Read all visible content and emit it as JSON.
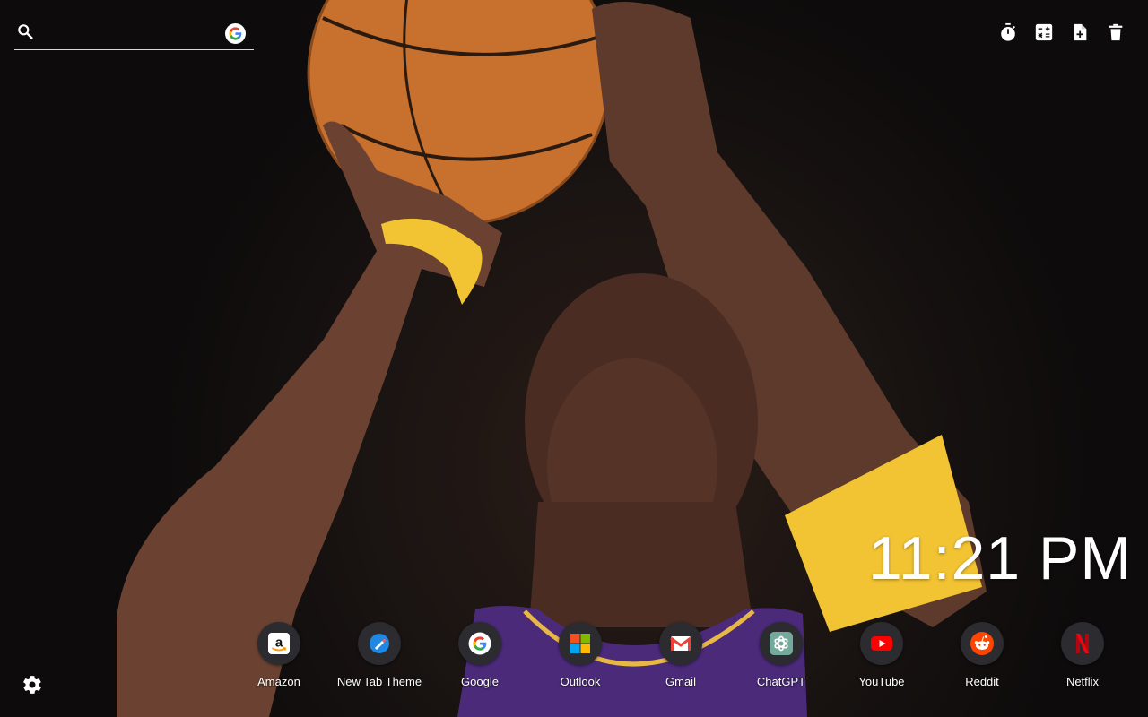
{
  "search": {
    "placeholder": "",
    "value": "",
    "engine_icon": "google-g-icon"
  },
  "toolbar": {
    "items": [
      {
        "icon": "stopwatch-icon"
      },
      {
        "icon": "calculator-icon"
      },
      {
        "icon": "add-note-icon"
      },
      {
        "icon": "trash-icon"
      }
    ]
  },
  "clock": {
    "time": "11:21 PM"
  },
  "shortcuts": [
    {
      "label": "Amazon",
      "icon": "amazon-icon"
    },
    {
      "label": "New Tab Theme",
      "icon": "new-tab-theme-icon"
    },
    {
      "label": "Google",
      "icon": "google-icon"
    },
    {
      "label": "Outlook",
      "icon": "outlook-icon"
    },
    {
      "label": "Gmail",
      "icon": "gmail-icon"
    },
    {
      "label": "ChatGPT",
      "icon": "chatgpt-icon"
    },
    {
      "label": "YouTube",
      "icon": "youtube-icon"
    },
    {
      "label": "Reddit",
      "icon": "reddit-icon"
    },
    {
      "label": "Netflix",
      "icon": "netflix-icon"
    }
  ],
  "settings": {
    "icon": "gear-icon"
  },
  "colors": {
    "text": "#ffffff",
    "bubble": "#2b2b30",
    "google_blue": "#4285F4",
    "google_red": "#EA4335",
    "google_yellow": "#FBBC05",
    "google_green": "#34A853",
    "youtube_red": "#FF0000",
    "reddit_orange": "#FF4500",
    "netflix_red": "#E50914",
    "jersey_purple": "#4b2a7a",
    "ball_orange": "#c8702d",
    "band_yellow": "#f2c332"
  }
}
